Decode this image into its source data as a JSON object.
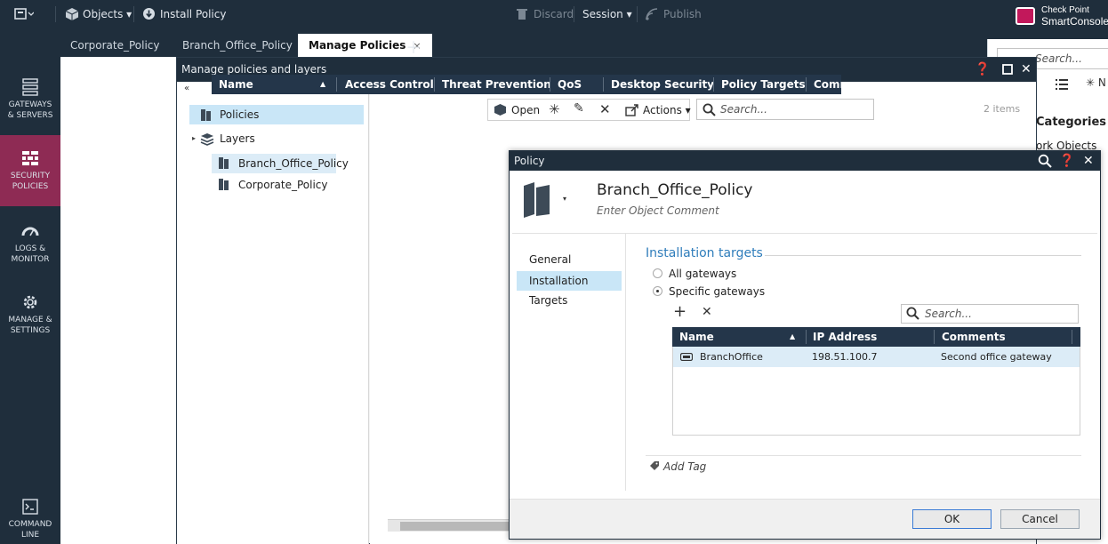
{
  "toolbar": {
    "objects": "Objects",
    "install_policy": "Install Policy",
    "discard": "Discard",
    "session": "Session",
    "publish": "Publish",
    "brand_line1": "Check Point",
    "brand_line2": "SmartConsole"
  },
  "tabs": [
    {
      "label": "Corporate_Policy"
    },
    {
      "label": "Branch_Office_Policy"
    },
    {
      "label": "Manage Policies",
      "close": "×"
    }
  ],
  "nav": [
    {
      "label1": "GATEWAYS",
      "label2": "& SERVERS"
    },
    {
      "label1": "SECURITY",
      "label2": "POLICIES"
    },
    {
      "label1": "LOGS &",
      "label2": "MONITOR"
    },
    {
      "label1": "MANAGE &",
      "label2": "SETTINGS"
    },
    {
      "label1": "COMMAND",
      "label2": "LINE"
    }
  ],
  "right_pane": {
    "search_fragment": "Search...",
    "categories": "Categories",
    "objects_fragment": "ork Objects",
    "new_fragment": "N"
  },
  "manage_dialog": {
    "title": "Manage policies and layers",
    "tree": [
      "Policies",
      "Layers"
    ],
    "toolbar": {
      "open": "Open",
      "actions": "Actions",
      "search_placeholder": "Search...",
      "count": "2 items"
    },
    "columns": [
      "Name",
      "Access Control",
      "Threat Prevention",
      "QoS",
      "Desktop Security",
      "Policy Targets",
      "Comm"
    ],
    "rows": [
      "Branch_Office_Policy",
      "Corporate_Policy"
    ]
  },
  "policy_dialog": {
    "title": "Policy",
    "name": "Branch_Office_Policy",
    "comment_placeholder": "Enter Object Comment",
    "nav": [
      "General",
      "Installation Targets"
    ],
    "section": "Installation targets",
    "radio_all": "All gateways",
    "radio_specific": "Specific gateways",
    "search_placeholder": "Search...",
    "grid_columns": [
      "Name",
      "IP Address",
      "Comments"
    ],
    "grid_row": {
      "name": "BranchOffice",
      "ip": "198.51.100.7",
      "comments": "Second office gateway"
    },
    "add_tag": "Add Tag",
    "ok": "OK",
    "cancel": "Cancel"
  },
  "colors": {
    "chrome": "#1f2e3c",
    "active_nav": "#8e2b54",
    "selection": "#c9e6f7",
    "accent_blue": "#2f7dbb"
  }
}
